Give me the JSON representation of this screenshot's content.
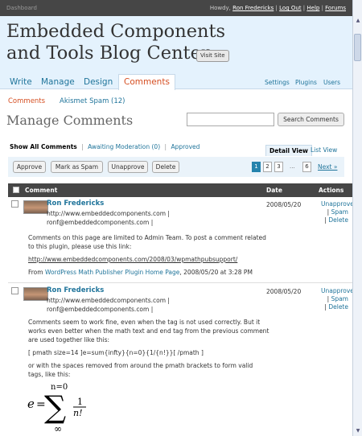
{
  "topbar": {
    "dashboard": "Dashboard",
    "howdy": "Howdy,",
    "user": "Ron Fredericks",
    "logout": "Log Out",
    "help": "Help",
    "forums": "Forums"
  },
  "header": {
    "title_line1": "Embedded Components",
    "title_line2": "and Tools Blog Center",
    "visit_site": "Visit Site"
  },
  "nav": {
    "main": [
      "Write",
      "Manage",
      "Design",
      "Comments"
    ],
    "active": "Comments",
    "util": [
      "Settings",
      "Plugins",
      "Users"
    ]
  },
  "subnav": {
    "current": "Comments",
    "other": "Akismet Spam (12)"
  },
  "page": {
    "title": "Manage Comments",
    "search_button": "Search Comments",
    "search_value": ""
  },
  "filters": {
    "all": "Show All Comments",
    "moderation": "Awaiting Moderation (0)",
    "approved": "Approved",
    "detail_view": "Detail View",
    "list_view": "List View"
  },
  "actions": {
    "approve": "Approve",
    "spam": "Mark as Spam",
    "unapprove": "Unapprove",
    "delete": "Delete"
  },
  "pagination": {
    "pages": [
      "1",
      "2",
      "3"
    ],
    "current": "1",
    "dots": "...",
    "last": "6",
    "next": "Next »"
  },
  "table": {
    "headers": [
      "Comment",
      "Date",
      "Actions"
    ]
  },
  "comments": [
    {
      "author": "Ron Fredericks",
      "url": "http://www.embeddedcomponents.com",
      "email": "ronf@embeddedcomponents.com",
      "date": "2008/05/20",
      "act_unapprove": "Unapprove",
      "act_spam": "Spam",
      "act_delete": "Delete",
      "p1": "Comments on this page are limited to Admin Team. To post a comment related to this plugin, please use this link:",
      "link": "http://www.embeddedcomponents.com/2008/03/wpmathpubsupport/",
      "from_prefix": "From",
      "from_link": "WordPress Math Publisher Plugin Home Page",
      "from_suffix": ", 2008/05/20 at 3:28 PM"
    },
    {
      "author": "Ron Fredericks",
      "url": "http://www.embeddedcomponents.com",
      "email": "ronf@embeddedcomponents.com",
      "date": "2008/05/20",
      "act_unapprove": "Unapprove",
      "act_spam": "Spam",
      "act_delete": "Delete",
      "p1": "Comments seem to work fine, even when the tag is not used correctly. But it works even better when the math text and end tag from the previous comment are used together like this:",
      "p2": "[ pmath size=14 ]e=sum{infty}{n=0}{1/{n!}}[ /pmath ]",
      "p3": "or with the spaces removed from around the pmath brackets to form valid tags, like this:"
    }
  ],
  "formula": {
    "lhs": "e",
    "eq": "=",
    "sigma": "∑",
    "upper": "n=0",
    "lower": "∞",
    "num": "1",
    "den": "n!"
  }
}
